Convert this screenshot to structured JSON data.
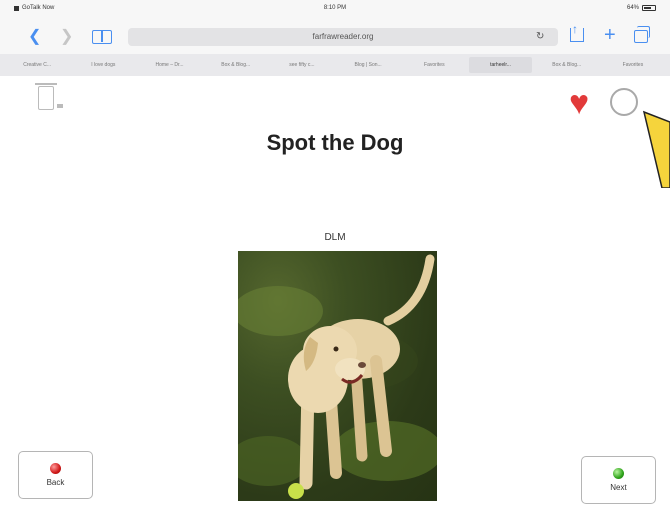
{
  "status_bar": {
    "carrier": "GoTalk Now",
    "time": "8:10 PM",
    "battery": "64%"
  },
  "browser": {
    "url": "farfrawreader.org",
    "bookmarks": [
      "Creative C...",
      "I love dogs",
      "Home – Dr...",
      "Box & Blog...",
      "see fifty c...",
      "Blog | Son...",
      "Favorites",
      "tarheelr...",
      "Box & Blog...",
      "Favorites"
    ],
    "active_bookmark_index": 7
  },
  "page": {
    "title": "Spot the Dog",
    "author": "DLM",
    "image_subject": "yellow-labrador-on-grass",
    "back_label": "Back",
    "next_label": "Next"
  },
  "colors": {
    "heart": "#e23a3a",
    "browser_accent": "#4a8ff0",
    "pointer_arrow": "#f5d43c",
    "back_dot": "#d01818",
    "next_dot": "#2fa31a"
  },
  "icons": {
    "trash": "trash-icon",
    "favorite": "heart-icon",
    "circle": "circle-icon"
  }
}
